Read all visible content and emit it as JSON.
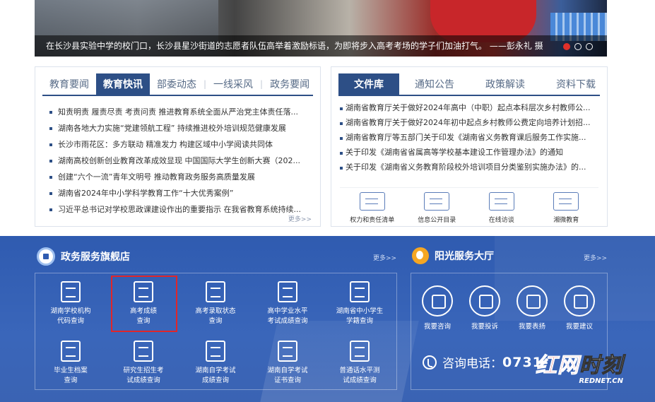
{
  "banner": {
    "caption": "在长沙县实验中学的校门口，长沙县星沙街道的志愿者队伍高举着激励标语，为即将步入高考考场的学子们加油打气。  ——彭永礼 摄"
  },
  "news_panel": {
    "tabs": [
      "教育要闻",
      "教育快讯",
      "部委动态",
      "一线采风",
      "政务要闻"
    ],
    "active_tab": "教育快讯",
    "items": [
      "知责明责 履责尽责 考责问责 推进教育系统全面从严治党主体责任落...",
      "湖南各地大力实施“党建领航工程” 持续推进校外培训规范健康发展",
      "长沙市雨花区：多方联动 精准发力 构建区域中小学阅读共同体",
      "湖南高校创新创业教育改革成效显现 中国国际大学生创新大赛（202...",
      "创建“六个一流”青年文明号 推动教育政务服务高质量发展",
      "湖南省2024年中小学科学教育工作“十大优秀案例”",
      "习近平总书记对学校思政课建设作出的重要指示 在我省教育系统持续..."
    ],
    "more": "更多>>"
  },
  "docs_panel": {
    "tabs": [
      "文件库",
      "通知公告",
      "政策解读",
      "资料下载"
    ],
    "active_tab": "文件库",
    "items": [
      "湖南省教育厅关于做好2024年高中（中职）起点本科层次乡村教师公...",
      "湖南省教育厅关于做好2024年初中起点乡村教师公费定向培养计划招...",
      "湖南省教育厅等五部门关于印发《湖南省义务教育课后服务工作实施...",
      "关于印发《湖南省省属高等学校基本建设工作管理办法》的通知",
      "关于印发《湖南省义务教育阶段校外培训项目分类鉴别实施办法》的..."
    ],
    "icons": [
      "权力和责任清单",
      "信息公开目录",
      "在线访谈",
      "湘微教育"
    ]
  },
  "flagship": {
    "title": "政务服务旗舰店",
    "more": "更多>>",
    "services": [
      "湖南学校机构\n代码查询",
      "高考成绩\n查询",
      "高考录取状态\n查询",
      "高中学业水平\n考试成绩查询",
      "湖南省中小学生\n学籍查询",
      "毕业生档案\n查询",
      "研究生招生考\n试成绩查询",
      "湖南自学考试\n成绩查询",
      "湖南自学考试\n证书查询",
      "普通话水平测\n试成绩查询"
    ]
  },
  "sunshine": {
    "title": "阳光服务大厅",
    "more": "更多>>",
    "items": [
      "我要咨询",
      "我要投诉",
      "我要表扬",
      "我要建议"
    ],
    "hotline_label": "咨询电话：",
    "hotline_number": "0731-"
  },
  "watermark": {
    "brand_red": "红网",
    "brand_white": "时刻",
    "domain": "REDNET.CN"
  },
  "colors": {
    "accent": "#2d4f86",
    "section_blue": "#3a66ba",
    "highlight_red": "#e0262a"
  }
}
